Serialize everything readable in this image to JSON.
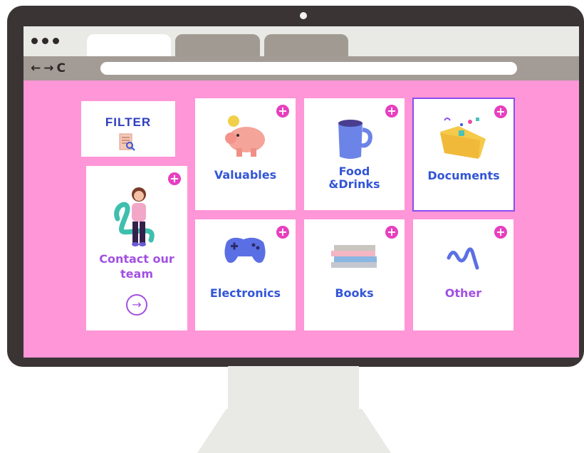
{
  "browser": {
    "nav_icons": {
      "back": "←",
      "forward": "→",
      "reload": "C"
    }
  },
  "filter": {
    "title": "FILTER",
    "icon": "search-icon"
  },
  "contact": {
    "label_line1": "Contact our",
    "label_line2": "team",
    "arrow": "→"
  },
  "categories": [
    {
      "label": "Valuables",
      "icon": "piggy-bank-icon",
      "plus": "+"
    },
    {
      "label_line1": "Food",
      "label_line2": "&Drinks",
      "icon": "mug-icon",
      "plus": "+"
    },
    {
      "label": "Documents",
      "icon": "folder-icon",
      "plus": "+",
      "selected": true
    },
    {
      "label": "Electronics",
      "icon": "gamepad-icon",
      "plus": "+"
    },
    {
      "label": "Books",
      "icon": "books-icon",
      "plus": "+"
    },
    {
      "label": "Other",
      "icon": "squiggle-icon",
      "plus": "+"
    }
  ],
  "colors": {
    "screen_bg": "#fe96d7",
    "label_blue": "#3356d6",
    "label_purple": "#a250e2",
    "plus_pink": "#e73fc0",
    "selected_border": "#8a4cf0"
  }
}
